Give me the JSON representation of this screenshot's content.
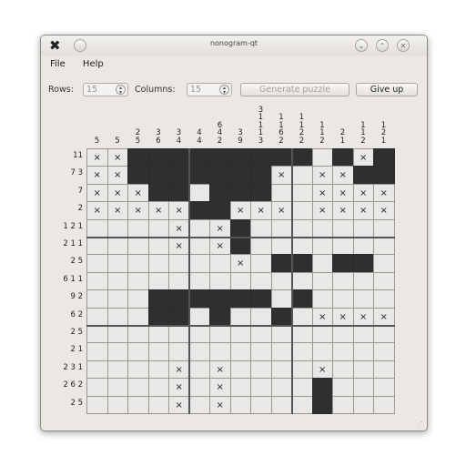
{
  "window": {
    "title": "nonogram-qt",
    "icon": "x-logo-icon",
    "controls": [
      "minimize",
      "maximize",
      "close"
    ]
  },
  "menu": {
    "items": [
      "File",
      "Help"
    ]
  },
  "toolbar": {
    "rows_label": "Rows:",
    "rows_value": "15",
    "columns_label": "Columns:",
    "columns_value": "15",
    "generate_label": "Generate puzzle",
    "giveup_label": "Give up"
  },
  "puzzle": {
    "column_clues": [
      [
        "5"
      ],
      [
        "5"
      ],
      [
        "2",
        "5"
      ],
      [
        "3",
        "6"
      ],
      [
        "3",
        "4"
      ],
      [
        "4",
        "4"
      ],
      [
        "6",
        "4",
        "2"
      ],
      [
        "3",
        "9"
      ],
      [
        "3",
        "1",
        "1",
        "1",
        "3"
      ],
      [
        "1",
        "1",
        "6",
        "2"
      ],
      [
        "1",
        "1",
        "2",
        "2"
      ],
      [
        "1",
        "1",
        "2"
      ],
      [
        "2",
        "1"
      ],
      [
        "1",
        "1",
        "2"
      ],
      [
        "1",
        "2",
        "1"
      ]
    ],
    "row_clues": [
      "11",
      "7 3",
      "7",
      "2",
      "1 2 1",
      "2 1 1",
      "2 5",
      "6 1 1",
      "9 2",
      "6 2",
      "2 5",
      "2 1",
      "2 3 1",
      "2 6 2",
      "2 5"
    ],
    "cells": [
      "xx#########.#x#x",
      "xx#######x.xx###",
      "xxx##.###..xxxxx",
      "xxxxx##xxx.xxxxx",
      "....x.x#........",
      "....x.x#........",
      ".......x.##.##..x",
      "...............",
      "...######.#.....",
      "...##.#..#.xxxx",
      "...............",
      "...............",
      "....x.x....x...",
      "....x.x....#...",
      "....x.x....#..."
    ]
  }
}
